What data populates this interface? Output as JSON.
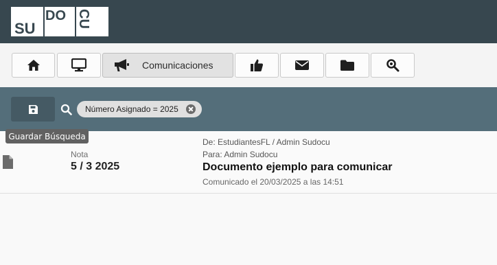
{
  "logo": {
    "letters": [
      "su",
      "DO",
      "CU"
    ]
  },
  "nav": [
    {
      "icon": "home-icon"
    },
    {
      "icon": "monitor-icon"
    },
    {
      "icon": "megaphone-icon",
      "label": "Comunicaciones",
      "active": true
    },
    {
      "icon": "thumbs-up-icon"
    },
    {
      "icon": "envelope-icon"
    },
    {
      "icon": "folder-icon"
    },
    {
      "icon": "search-settings-icon"
    }
  ],
  "search": {
    "save_icon": "floppy-disk-icon",
    "filter_chip": "Número Asignado = 2025",
    "tooltip": "Guardar Búsqueda"
  },
  "results": [
    {
      "icon": "document-icon",
      "type": "Nota",
      "number": "5 / 3 2025",
      "from": "De: EstudiantesFL / Admin Sudocu",
      "to": "Para: Admin Sudocu",
      "subject": "Documento ejemplo para comunicar",
      "date": "Comunicado el 20/03/2025 a las 14:51"
    }
  ],
  "colors": {
    "topbar": "#37474f",
    "searchbar": "#546e7a",
    "save_button": "#455a64"
  }
}
